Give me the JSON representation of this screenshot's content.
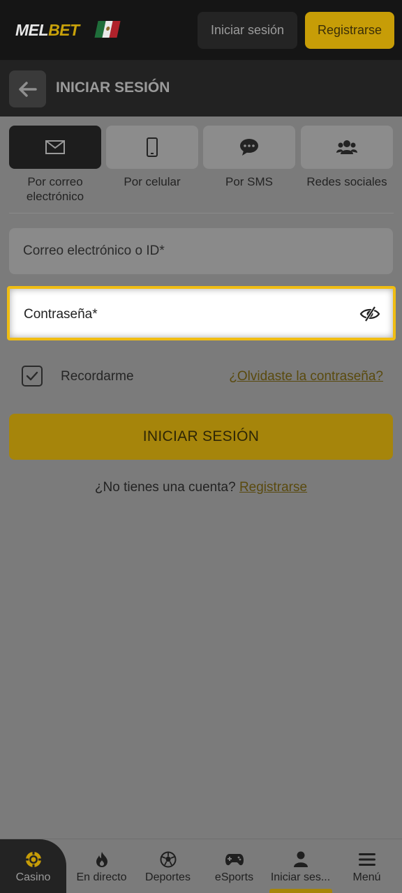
{
  "header": {
    "logo_mel": "MEL",
    "logo_bet": "BET",
    "login_label": "Iniciar sesión",
    "register_label": "Registrarse"
  },
  "titlebar": {
    "title": "INICIAR SESIÓN"
  },
  "tabs": [
    {
      "label": "Por correo electrónico",
      "icon": "envelope-icon",
      "active": true
    },
    {
      "label": "Por celular",
      "icon": "phone-icon",
      "active": false
    },
    {
      "label": "Por SMS",
      "icon": "chat-bubble-icon",
      "active": false
    },
    {
      "label": "Redes sociales",
      "icon": "users-icon",
      "active": false
    }
  ],
  "form": {
    "email_placeholder": "Correo electrónico o ID*",
    "password_placeholder": "Contraseña*",
    "remember_label": "Recordarme",
    "remember_checked": true,
    "forgot_label": "¿Olvidaste la contraseña?",
    "submit_label": "INICIAR SESIÓN",
    "no_account_text": "¿No tienes una cuenta?",
    "signup_link": "Registrarse"
  },
  "bottom_nav": [
    {
      "label": "Casino",
      "icon": "casino-chip-icon",
      "active": true
    },
    {
      "label": "En directo",
      "icon": "flame-icon"
    },
    {
      "label": "Deportes",
      "icon": "soccer-ball-icon"
    },
    {
      "label": "eSports",
      "icon": "gamepad-icon"
    },
    {
      "label": "Iniciar ses...",
      "icon": "user-icon",
      "selected": true
    },
    {
      "label": "Menú",
      "icon": "hamburger-icon"
    }
  ],
  "colors": {
    "accent": "#c79d07",
    "highlight_border": "#f0bd13",
    "header_bg": "#151515"
  }
}
